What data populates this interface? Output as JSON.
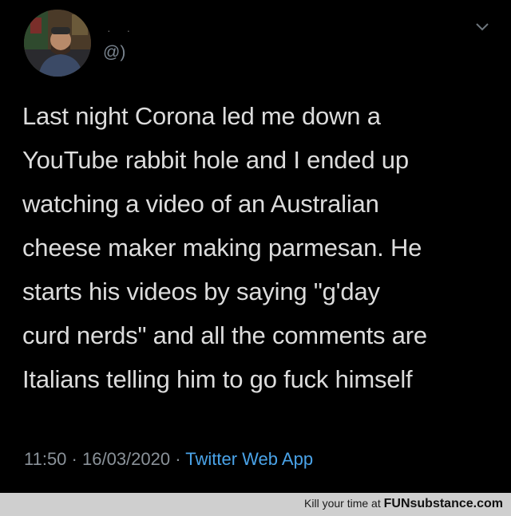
{
  "tweet": {
    "display_name": "· ·",
    "handle": "@)",
    "text_lines": [
      "Last night Corona led me down a",
      "YouTube rabbit hole and I ended up",
      "watching a video of an Australian",
      "cheese maker making parmesan. He",
      "starts his videos by saying \"g'day",
      "curd nerds\" and all the comments are",
      "Italians telling him to go fuck himself"
    ],
    "time": "11:50",
    "separator": "·",
    "date": "16/03/2020",
    "source": "Twitter Web App",
    "menu_icon": "chevron-down-icon",
    "avatar_icon": "profile-photo"
  },
  "footer": {
    "prefix": "Kill your time at ",
    "brand": "FUNsubstance.com"
  },
  "colors": {
    "background": "#000000",
    "text": "#dcdcdc",
    "meta": "#8a9299",
    "link": "#4aa3e8",
    "footer_bg": "#cfcfcf"
  }
}
